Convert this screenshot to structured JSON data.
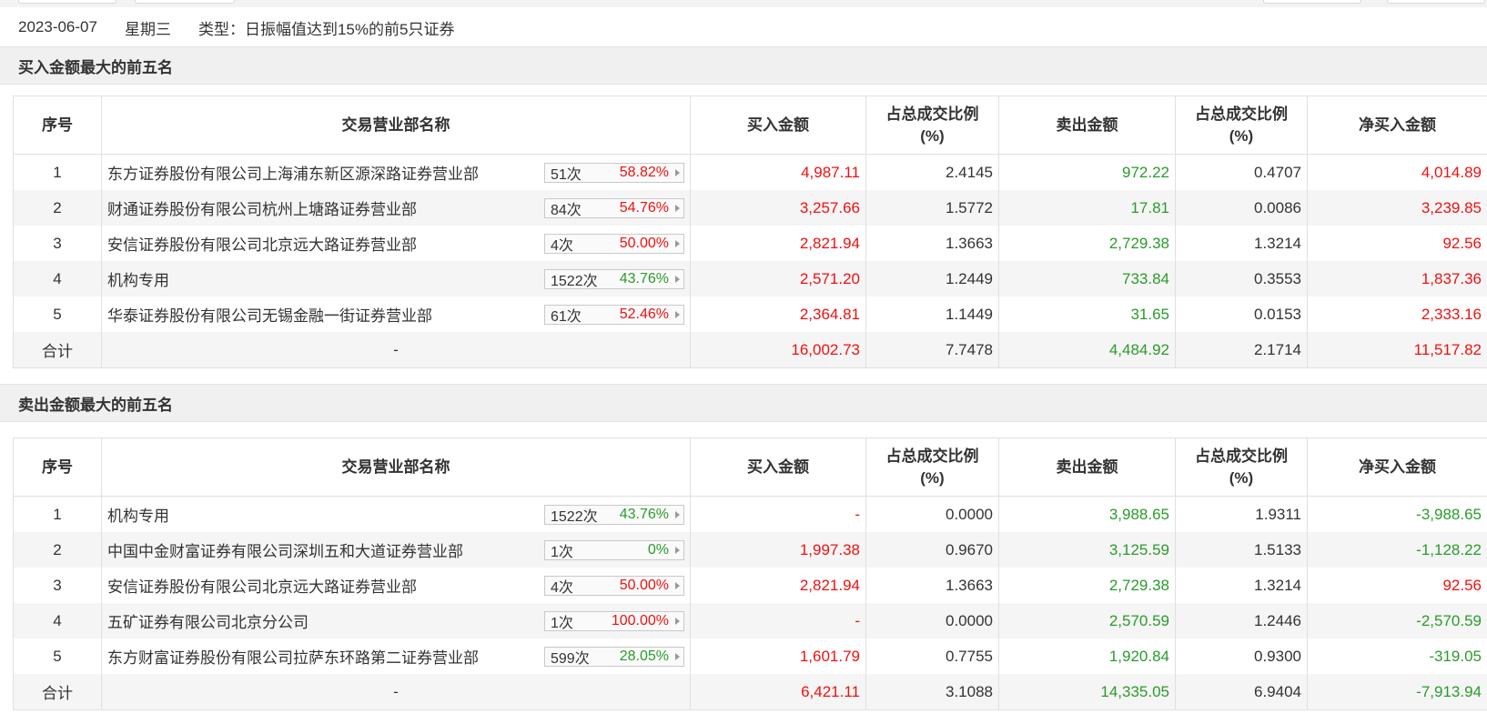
{
  "info": {
    "date": "2023-06-07",
    "weekday": "星期三",
    "type_text": "类型：日振幅值达到15%的前5只证券"
  },
  "headers": {
    "idx": "序号",
    "dept": "交易营业部名称",
    "buy": "买入金额",
    "ratio1_line1": "占总成交比例",
    "ratio1_line2": "(%)",
    "sell": "卖出金额",
    "ratio2_line1": "占总成交比例",
    "ratio2_line2": "(%)",
    "net": "净买入金额"
  },
  "colors": {
    "up": "#f01010",
    "down": "#2a9b2a"
  },
  "buy_section": {
    "title": "买入金额最大的前五名",
    "rows": [
      {
        "idx": "1",
        "name": "东方证券股份有限公司上海浦东新区源深路证券营业部",
        "count": "51次",
        "pct": "58.82%",
        "pct_color": "red",
        "buy": "4,987.11",
        "buy_color": "red",
        "ratio1": "2.4145",
        "sell": "972.22",
        "ratio2": "0.4707",
        "net": "4,014.89",
        "net_color": "red"
      },
      {
        "idx": "2",
        "name": "财通证券股份有限公司杭州上塘路证券营业部",
        "count": "84次",
        "pct": "54.76%",
        "pct_color": "red",
        "buy": "3,257.66",
        "buy_color": "red",
        "ratio1": "1.5772",
        "sell": "17.81",
        "ratio2": "0.0086",
        "net": "3,239.85",
        "net_color": "red"
      },
      {
        "idx": "3",
        "name": "安信证券股份有限公司北京远大路证券营业部",
        "count": "4次",
        "pct": "50.00%",
        "pct_color": "red",
        "buy": "2,821.94",
        "buy_color": "red",
        "ratio1": "1.3663",
        "sell": "2,729.38",
        "ratio2": "1.3214",
        "net": "92.56",
        "net_color": "red"
      },
      {
        "idx": "4",
        "name": "机构专用",
        "count": "1522次",
        "pct": "43.76%",
        "pct_color": "green",
        "buy": "2,571.20",
        "buy_color": "red",
        "ratio1": "1.2449",
        "sell": "733.84",
        "ratio2": "0.3553",
        "net": "1,837.36",
        "net_color": "red"
      },
      {
        "idx": "5",
        "name": "华泰证券股份有限公司无锡金融一街证券营业部",
        "count": "61次",
        "pct": "52.46%",
        "pct_color": "red",
        "buy": "2,364.81",
        "buy_color": "red",
        "ratio1": "1.1449",
        "sell": "31.65",
        "ratio2": "0.0153",
        "net": "2,333.16",
        "net_color": "red"
      }
    ],
    "total": {
      "label": "合计",
      "name": "-",
      "buy": "16,002.73",
      "ratio1": "7.7478",
      "sell": "4,484.92",
      "ratio2": "2.1714",
      "net": "11,517.82",
      "net_color": "red"
    }
  },
  "sell_section": {
    "title": "卖出金额最大的前五名",
    "rows": [
      {
        "idx": "1",
        "name": "机构专用",
        "count": "1522次",
        "pct": "43.76%",
        "pct_color": "green",
        "buy": "-",
        "buy_color": "red",
        "ratio1": "0.0000",
        "sell": "3,988.65",
        "ratio2": "1.9311",
        "net": "-3,988.65",
        "net_color": "green"
      },
      {
        "idx": "2",
        "name": "中国中金财富证券有限公司深圳五和大道证券营业部",
        "count": "1次",
        "pct": "0%",
        "pct_color": "green",
        "buy": "1,997.38",
        "buy_color": "red",
        "ratio1": "0.9670",
        "sell": "3,125.59",
        "ratio2": "1.5133",
        "net": "-1,128.22",
        "net_color": "green"
      },
      {
        "idx": "3",
        "name": "安信证券股份有限公司北京远大路证券营业部",
        "count": "4次",
        "pct": "50.00%",
        "pct_color": "red",
        "buy": "2,821.94",
        "buy_color": "red",
        "ratio1": "1.3663",
        "sell": "2,729.38",
        "ratio2": "1.3214",
        "net": "92.56",
        "net_color": "red"
      },
      {
        "idx": "4",
        "name": "五矿证券有限公司北京分公司",
        "count": "1次",
        "pct": "100.00%",
        "pct_color": "red",
        "buy": "-",
        "buy_color": "red",
        "ratio1": "0.0000",
        "sell": "2,570.59",
        "ratio2": "1.2446",
        "net": "-2,570.59",
        "net_color": "green"
      },
      {
        "idx": "5",
        "name": "东方财富证券股份有限公司拉萨东环路第二证券营业部",
        "count": "599次",
        "pct": "28.05%",
        "pct_color": "green",
        "buy": "1,601.79",
        "buy_color": "red",
        "ratio1": "0.7755",
        "sell": "1,920.84",
        "ratio2": "0.9300",
        "net": "-319.05",
        "net_color": "green"
      }
    ],
    "total": {
      "label": "合计",
      "name": "-",
      "buy": "6,421.11",
      "ratio1": "3.1088",
      "sell": "14,335.05",
      "ratio2": "6.9404",
      "net": "-7,913.94",
      "net_color": "green"
    }
  }
}
